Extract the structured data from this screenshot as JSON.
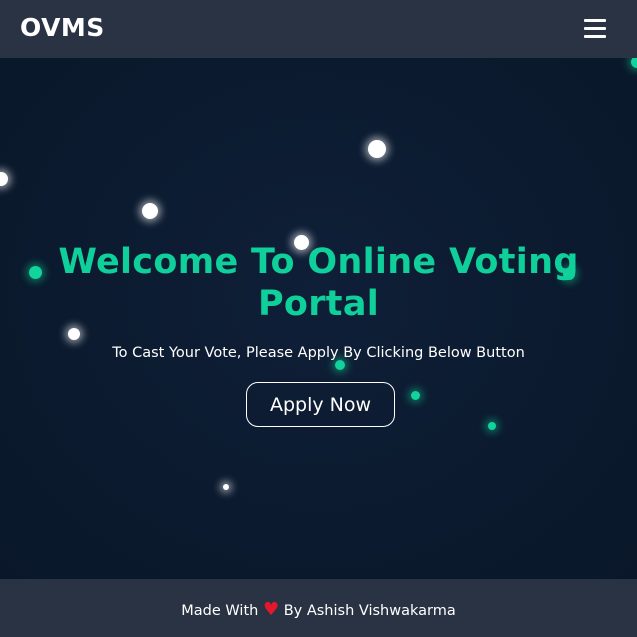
{
  "navbar": {
    "brand": "OVMS",
    "menu_icon": "hamburger-menu-icon"
  },
  "hero": {
    "headline": "Welcome To Online Voting Portal",
    "subtitle": "To Cast Your Vote, Please Apply By Clicking Below Button",
    "apply_label": "Apply Now"
  },
  "footer": {
    "made_with": "Made With",
    "heart": "♥",
    "author": "By Ashish Vishwakarma"
  },
  "colors": {
    "navbar_bg": "#2a3343",
    "hero_bg": "#0b1a2e",
    "accent_green": "#0fcf9a",
    "heart_red": "#e3182d",
    "particle_white": "#ffffff",
    "particle_green": "#10d49b"
  }
}
